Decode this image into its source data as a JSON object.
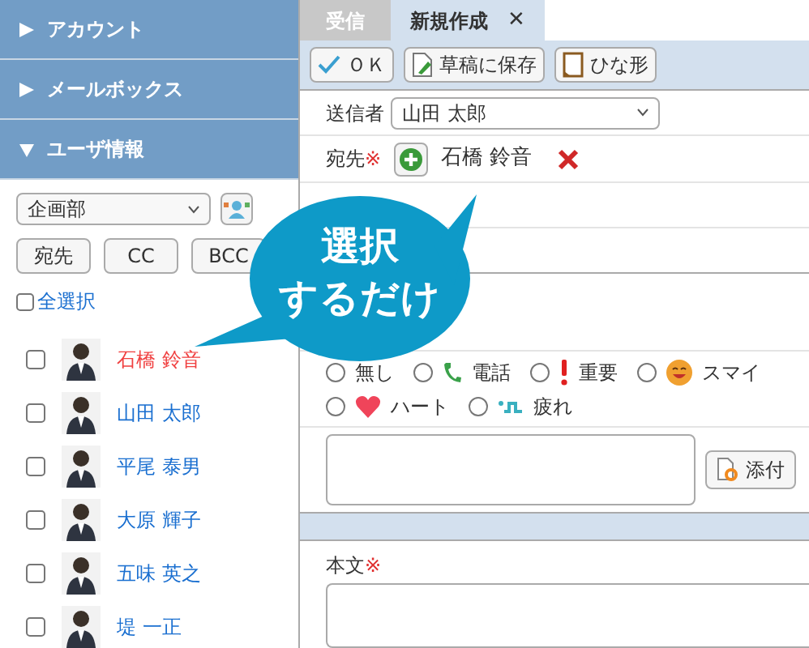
{
  "sidebar": {
    "sections": [
      {
        "label": "アカウント",
        "expanded": false
      },
      {
        "label": "メールボックス",
        "expanded": false
      },
      {
        "label": "ユーザ情報",
        "expanded": true
      }
    ],
    "group_select": {
      "value": "企画部"
    },
    "buttons": [
      "宛先",
      "CC",
      "BCC"
    ],
    "select_all": {
      "label": "全選択",
      "checked": false
    },
    "users": [
      {
        "name": "石橋 鈴音",
        "checked": false,
        "selected": true
      },
      {
        "name": "山田 太郎",
        "checked": false,
        "selected": false
      },
      {
        "name": "平尾 泰男",
        "checked": false,
        "selected": false
      },
      {
        "name": "大原 輝子",
        "checked": false,
        "selected": false
      },
      {
        "name": "五味 英之",
        "checked": false,
        "selected": false
      },
      {
        "name": "堤 一正",
        "checked": false,
        "selected": false
      }
    ]
  },
  "tabs": [
    {
      "label": "受信",
      "selected": false
    },
    {
      "label": "新規作成",
      "selected": true,
      "close": "✕"
    }
  ],
  "toolbar": [
    {
      "label": "ＯＫ",
      "kind": "check"
    },
    {
      "label": "草稿に保存",
      "kind": "save"
    },
    {
      "label": "ひな形",
      "kind": "template"
    }
  ],
  "form": {
    "sender_label": "送信者",
    "sender": "山田 太郎",
    "to_label": "宛先",
    "required": "※",
    "recipient": "石橋 鈴音",
    "marks": [
      {
        "label": "無し",
        "kind": "none",
        "selected": false
      },
      {
        "label": "電話",
        "kind": "phone",
        "selected": false
      },
      {
        "label": "重要",
        "kind": "important",
        "selected": false
      },
      {
        "label": "スマイ",
        "kind": "smile",
        "selected": false
      },
      {
        "label": "ハート",
        "kind": "heart",
        "selected": false
      },
      {
        "label": "疲れ",
        "kind": "tired",
        "selected": false
      }
    ],
    "attach": "添付",
    "body_label": "本文"
  },
  "callout": [
    "選択",
    "するだけ"
  ]
}
